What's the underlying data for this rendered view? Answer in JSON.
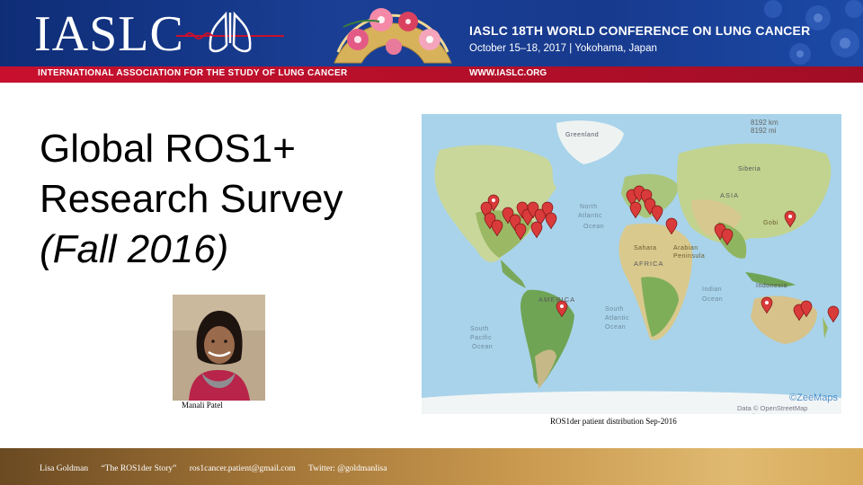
{
  "banner": {
    "logo": "IASLC",
    "association": "INTERNATIONAL ASSOCIATION FOR THE STUDY OF LUNG CANCER",
    "conference_title": "IASLC 18TH WORLD CONFERENCE ON LUNG CANCER",
    "conference_dates": "October 15–18, 2017 | Yokohama, Japan",
    "website": "WWW.IASLC.ORG",
    "colors": {
      "navy": "#1a3f95",
      "red": "#c8102e"
    }
  },
  "slide": {
    "title_line1": "Global ROS1+",
    "title_line2": "Research Survey",
    "title_line3": "(Fall 2016)",
    "photo_caption": "Manali Patel"
  },
  "map": {
    "caption": "ROS1der patient distribution Sep-2016",
    "scale_km": "8192 km",
    "scale_mi": "8192 mi",
    "attribution_logo": "©ZeeMaps",
    "attribution": "Data © OpenStreetMap contributors",
    "labels": {
      "greenland": "Greenland",
      "north_atlantic": "North",
      "atlantic": "Atlantic",
      "ocean": "Ocean",
      "africa": "AFRICA",
      "sahara": "Sahara",
      "arabian": "Arabian",
      "peninsula": "Peninsula",
      "asia": "ASIA",
      "siberia": "Siberia",
      "gobi": "Gobi",
      "indian": "Indian",
      "indian_ocean": "Ocean",
      "indonesia": "Indonesia",
      "america": "AMERICA",
      "south": "South",
      "south_atlantic": "Atlantic",
      "south_atlantic_ocean": "Ocean",
      "south_pacific": "South",
      "pacific": "Pacific",
      "pacific_ocean": "Ocean"
    },
    "pin_color": "#d93a3a"
  },
  "footer": {
    "author": "Lisa Goldman",
    "story": "“The ROS1der Story”",
    "email": "ros1cancer.patient@gmail.com",
    "twitter": "Twitter:  @goldmanlisa"
  }
}
